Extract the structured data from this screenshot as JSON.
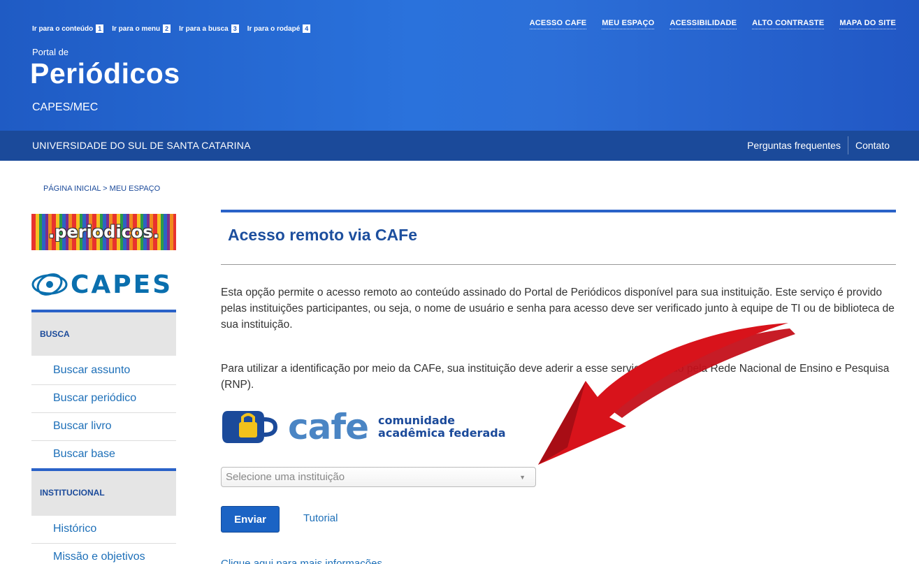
{
  "skip_links": [
    {
      "label": "Ir para o conteúdo",
      "key": "1"
    },
    {
      "label": "Ir para o menu",
      "key": "2"
    },
    {
      "label": "Ir para a busca",
      "key": "3"
    },
    {
      "label": "Ir para o rodapé",
      "key": "4"
    }
  ],
  "top_nav": [
    "ACESSO CAFE",
    "MEU ESPAÇO",
    "ACESSIBILIDADE",
    "ALTO CONTRASTE",
    "MAPA DO SITE"
  ],
  "brand": {
    "pre": "Portal de",
    "main": "Periódicos",
    "sub": "CAPES/MEC"
  },
  "institution_bar": {
    "name": "UNIVERSIDADE DO SUL DE SANTA CATARINA",
    "links": [
      "Perguntas frequentes",
      "Contato"
    ]
  },
  "breadcrumb": "PÁGINA INICIAL > MEU ESPAÇO",
  "logos": {
    "periodicos": ".periodicos.",
    "capes": "CAPES"
  },
  "sidebar": {
    "busca_title": "BUSCA",
    "busca_items": [
      "Buscar assunto",
      "Buscar periódico",
      "Buscar livro",
      "Buscar base"
    ],
    "inst_title": "INSTITUCIONAL",
    "inst_items": [
      "Histórico",
      "Missão e objetivos"
    ]
  },
  "main": {
    "title": "Acesso remoto via CAFe",
    "para1": "Esta opção permite o acesso remoto ao conteúdo assinado do Portal de Periódicos disponível para sua instituição. Este serviço é provido pelas instituições participantes, ou seja, o nome de usuário e senha para acesso deve ser verificado junto à equipe de TI ou de biblioteca de sua instituição.",
    "para2": "Para utilizar a identificação por meio da CAFe, sua instituição deve aderir a esse serviço provido pela Rede Nacional de Ensino e Pesquisa (RNP).",
    "cafe_word": "cafe",
    "cafe_sub1": "comunidade",
    "cafe_sub2": "acadêmica federada",
    "select_placeholder": "Selecione uma instituição",
    "submit_label": "Enviar",
    "tutorial_label": "Tutorial",
    "more_link": "Clique aqui para mais informações"
  },
  "colors": {
    "header_blue": "#2a72dc",
    "inst_bar": "#1b4a9a",
    "link_blue": "#1d6fb8",
    "annotation_arrow": "#d8131b"
  }
}
